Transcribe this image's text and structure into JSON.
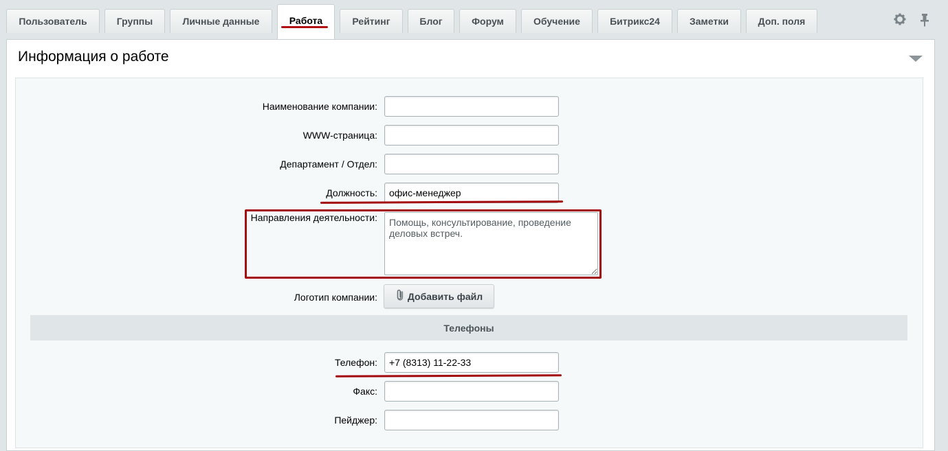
{
  "tabs": [
    {
      "label": "Пользователь",
      "active": false
    },
    {
      "label": "Группы",
      "active": false
    },
    {
      "label": "Личные данные",
      "active": false
    },
    {
      "label": "Работа",
      "active": true
    },
    {
      "label": "Рейтинг",
      "active": false
    },
    {
      "label": "Блог",
      "active": false
    },
    {
      "label": "Форум",
      "active": false
    },
    {
      "label": "Обучение",
      "active": false
    },
    {
      "label": "Битрикс24",
      "active": false
    },
    {
      "label": "Заметки",
      "active": false
    },
    {
      "label": "Доп. поля",
      "active": false
    }
  ],
  "toolbar": {
    "settings_icon": "gear-icon",
    "pin_icon": "pin-icon"
  },
  "section": {
    "title": "Информация о работе",
    "collapse_icon": "triangle-down-icon"
  },
  "fields": {
    "company_name": {
      "label": "Наименование компании:",
      "value": ""
    },
    "www": {
      "label": "WWW-страница:",
      "value": ""
    },
    "department": {
      "label": "Департамент / Отдел:",
      "value": ""
    },
    "position": {
      "label": "Должность:",
      "value": "офис-менеджер"
    },
    "profile": {
      "label": "Направления деятельности:",
      "value": "Помощь, консультирование, проведение деловых встреч."
    },
    "logo": {
      "label": "Логотип компании:",
      "button": "Добавить файл",
      "icon": "paperclip-icon"
    }
  },
  "phones": {
    "title": "Телефоны",
    "phone": {
      "label": "Телефон:",
      "value": "+7 (8313) 11-22-33"
    },
    "fax": {
      "label": "Факс:",
      "value": ""
    },
    "pager": {
      "label": "Пейджер:",
      "value": ""
    }
  },
  "colors": {
    "highlight": "#a3090e",
    "background": "#e0e6e8",
    "panel": "#ffffff"
  }
}
